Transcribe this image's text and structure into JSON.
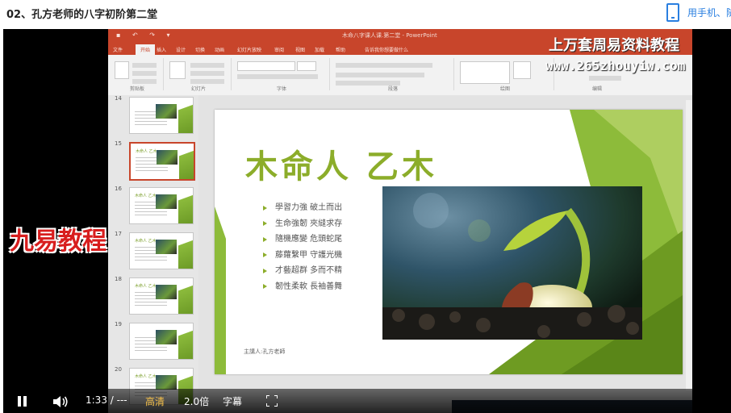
{
  "page": {
    "title": "02、孔方老师的八字初阶第二堂",
    "phone_link": "用手机、随"
  },
  "ppt": {
    "window_title": "木命八字课人课.第二堂 - PowerPoint",
    "tabs": [
      "文件",
      "开始",
      "插入",
      "设计",
      "切换",
      "动画",
      "幻灯片放映",
      "审阅",
      "视图",
      "加载",
      "帮助",
      "告诉我你想要做什么"
    ],
    "active_tab": "开始",
    "ribbon_groups": [
      "剪贴板",
      "幻灯片",
      "字体",
      "段落",
      "绘图",
      "编辑"
    ],
    "thumbnails": [
      {
        "num": "14"
      },
      {
        "num": "15",
        "title": "木命人 乙木"
      },
      {
        "num": "16",
        "title": "木命人 乙木"
      },
      {
        "num": "17",
        "title": "木命人 乙木"
      },
      {
        "num": "18",
        "title": "木命人 乙木"
      },
      {
        "num": "19"
      },
      {
        "num": "20",
        "title": "木命人 乙木"
      }
    ]
  },
  "slide": {
    "title": "木命人  乙木",
    "bullets": [
      "學習力強  破土而出",
      "生命強韌  夾縫求存",
      "隨機應變  危頭蛇尾",
      "藤蘿繫甲  守護光機",
      "才藝超群  多而不精",
      "韌性柔軟  長袖善舞"
    ],
    "presenter": "主講人:孔方老師"
  },
  "watermarks": {
    "top": "上万套周易资料教程",
    "url": "www.265zhouyiw.com",
    "side": "九易教程"
  },
  "player": {
    "time": "1:33 / ---",
    "quality": "高清",
    "speed": "2.0倍",
    "subtitle": "字幕"
  },
  "colors": {
    "accent_green": "#8cad2a",
    "ppt_red": "#c8452b",
    "link_blue": "#2a7fe0",
    "quality_gold": "#f5c04a"
  }
}
